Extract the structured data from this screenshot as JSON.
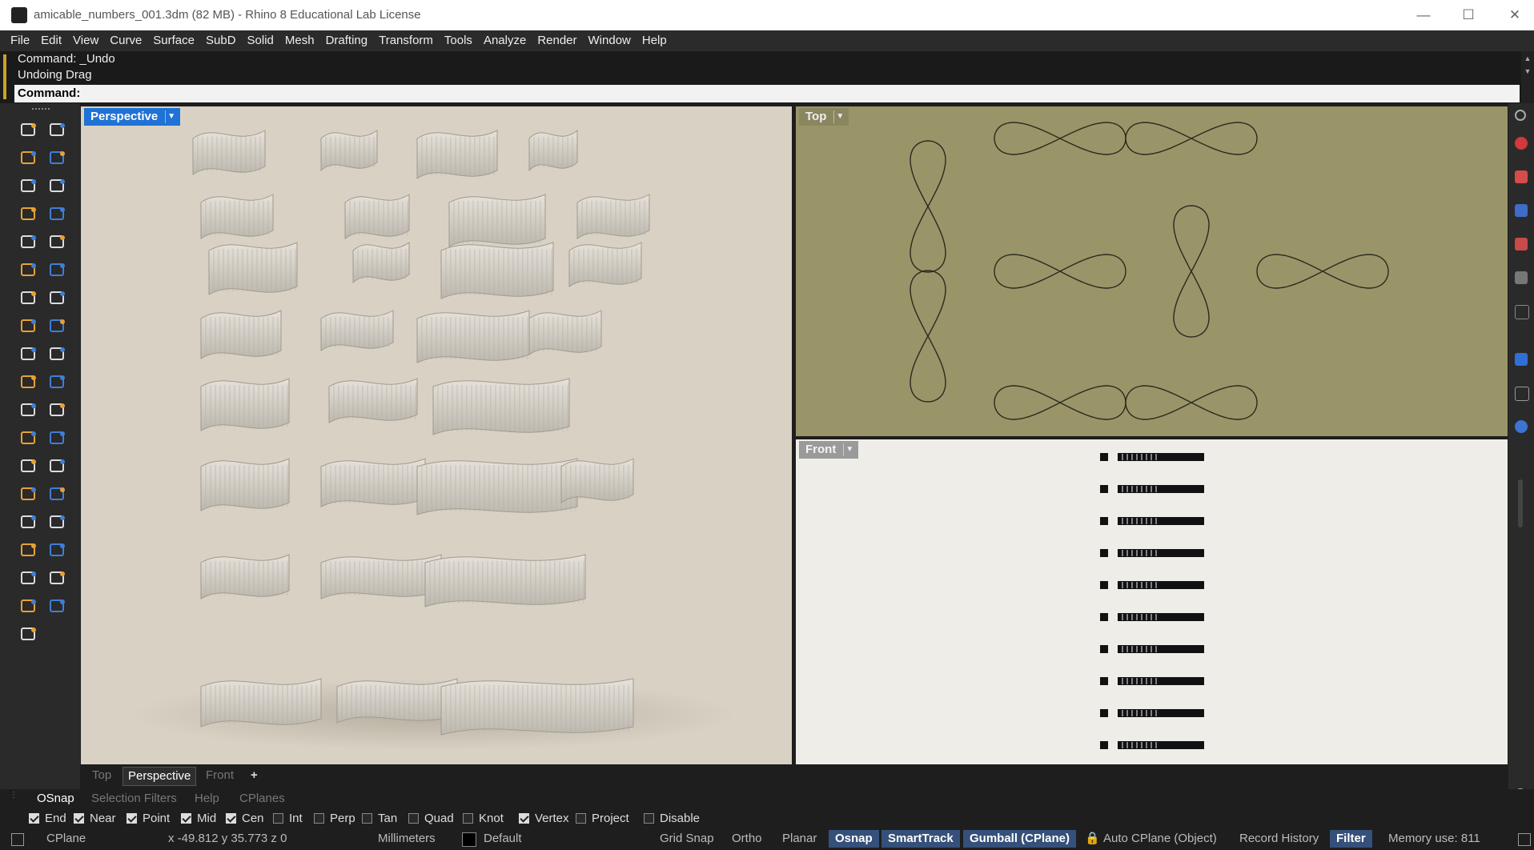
{
  "window": {
    "title": "amicable_numbers_001.3dm (82 MB) - Rhino 8 Educational Lab License",
    "minimize_icon": "minimize-icon",
    "maximize_icon": "maximize-icon",
    "close_icon": "close-icon"
  },
  "menu": [
    "File",
    "Edit",
    "View",
    "Curve",
    "Surface",
    "SubD",
    "Solid",
    "Mesh",
    "Drafting",
    "Transform",
    "Tools",
    "Analyze",
    "Render",
    "Window",
    "Help"
  ],
  "command": {
    "history": [
      "Command: _Undo",
      "Undoing Drag"
    ],
    "prompt_label": "Command:"
  },
  "viewports": {
    "perspective": {
      "label": "Perspective"
    },
    "top": {
      "label": "Top"
    },
    "front": {
      "label": "Front"
    }
  },
  "viewport_tabs": [
    "Top",
    "Perspective",
    "Front"
  ],
  "viewport_tabs_active": "Perspective",
  "add_tab_glyph": "+",
  "panel_tabs": [
    "OSnap",
    "Selection Filters",
    "Help",
    "CPlanes"
  ],
  "panel_tabs_active": "OSnap",
  "osnap": [
    {
      "label": "End",
      "checked": true
    },
    {
      "label": "Near",
      "checked": true
    },
    {
      "label": "Point",
      "checked": true
    },
    {
      "label": "Mid",
      "checked": true
    },
    {
      "label": "Cen",
      "checked": true
    },
    {
      "label": "Int",
      "checked": false
    },
    {
      "label": "Perp",
      "checked": false
    },
    {
      "label": "Tan",
      "checked": false
    },
    {
      "label": "Quad",
      "checked": false
    },
    {
      "label": "Knot",
      "checked": false
    },
    {
      "label": "Vertex",
      "checked": true
    },
    {
      "label": "Project",
      "checked": false
    },
    {
      "label": "Disable",
      "checked": false
    }
  ],
  "status": {
    "cplane": "CPlane",
    "coords": "x -49.812   y 35.773   z 0",
    "units": "Millimeters",
    "layer": "Default",
    "grid_snap": "Grid Snap",
    "ortho": "Ortho",
    "planar": "Planar",
    "osnap": "Osnap",
    "smarttrack": "SmartTrack",
    "gumball": "Gumball (CPlane)",
    "auto_cplane": "Auto CPlane (Object)",
    "record_history": "Record History",
    "filter": "Filter",
    "memory": "Memory use: 811"
  },
  "colors": {
    "accent": "#1f72d6",
    "top_viewport_bg": "#999568",
    "front_viewport_bg": "#eeede8",
    "perspective_bg": "#d9d2c4",
    "status_pill": "#35507a"
  }
}
